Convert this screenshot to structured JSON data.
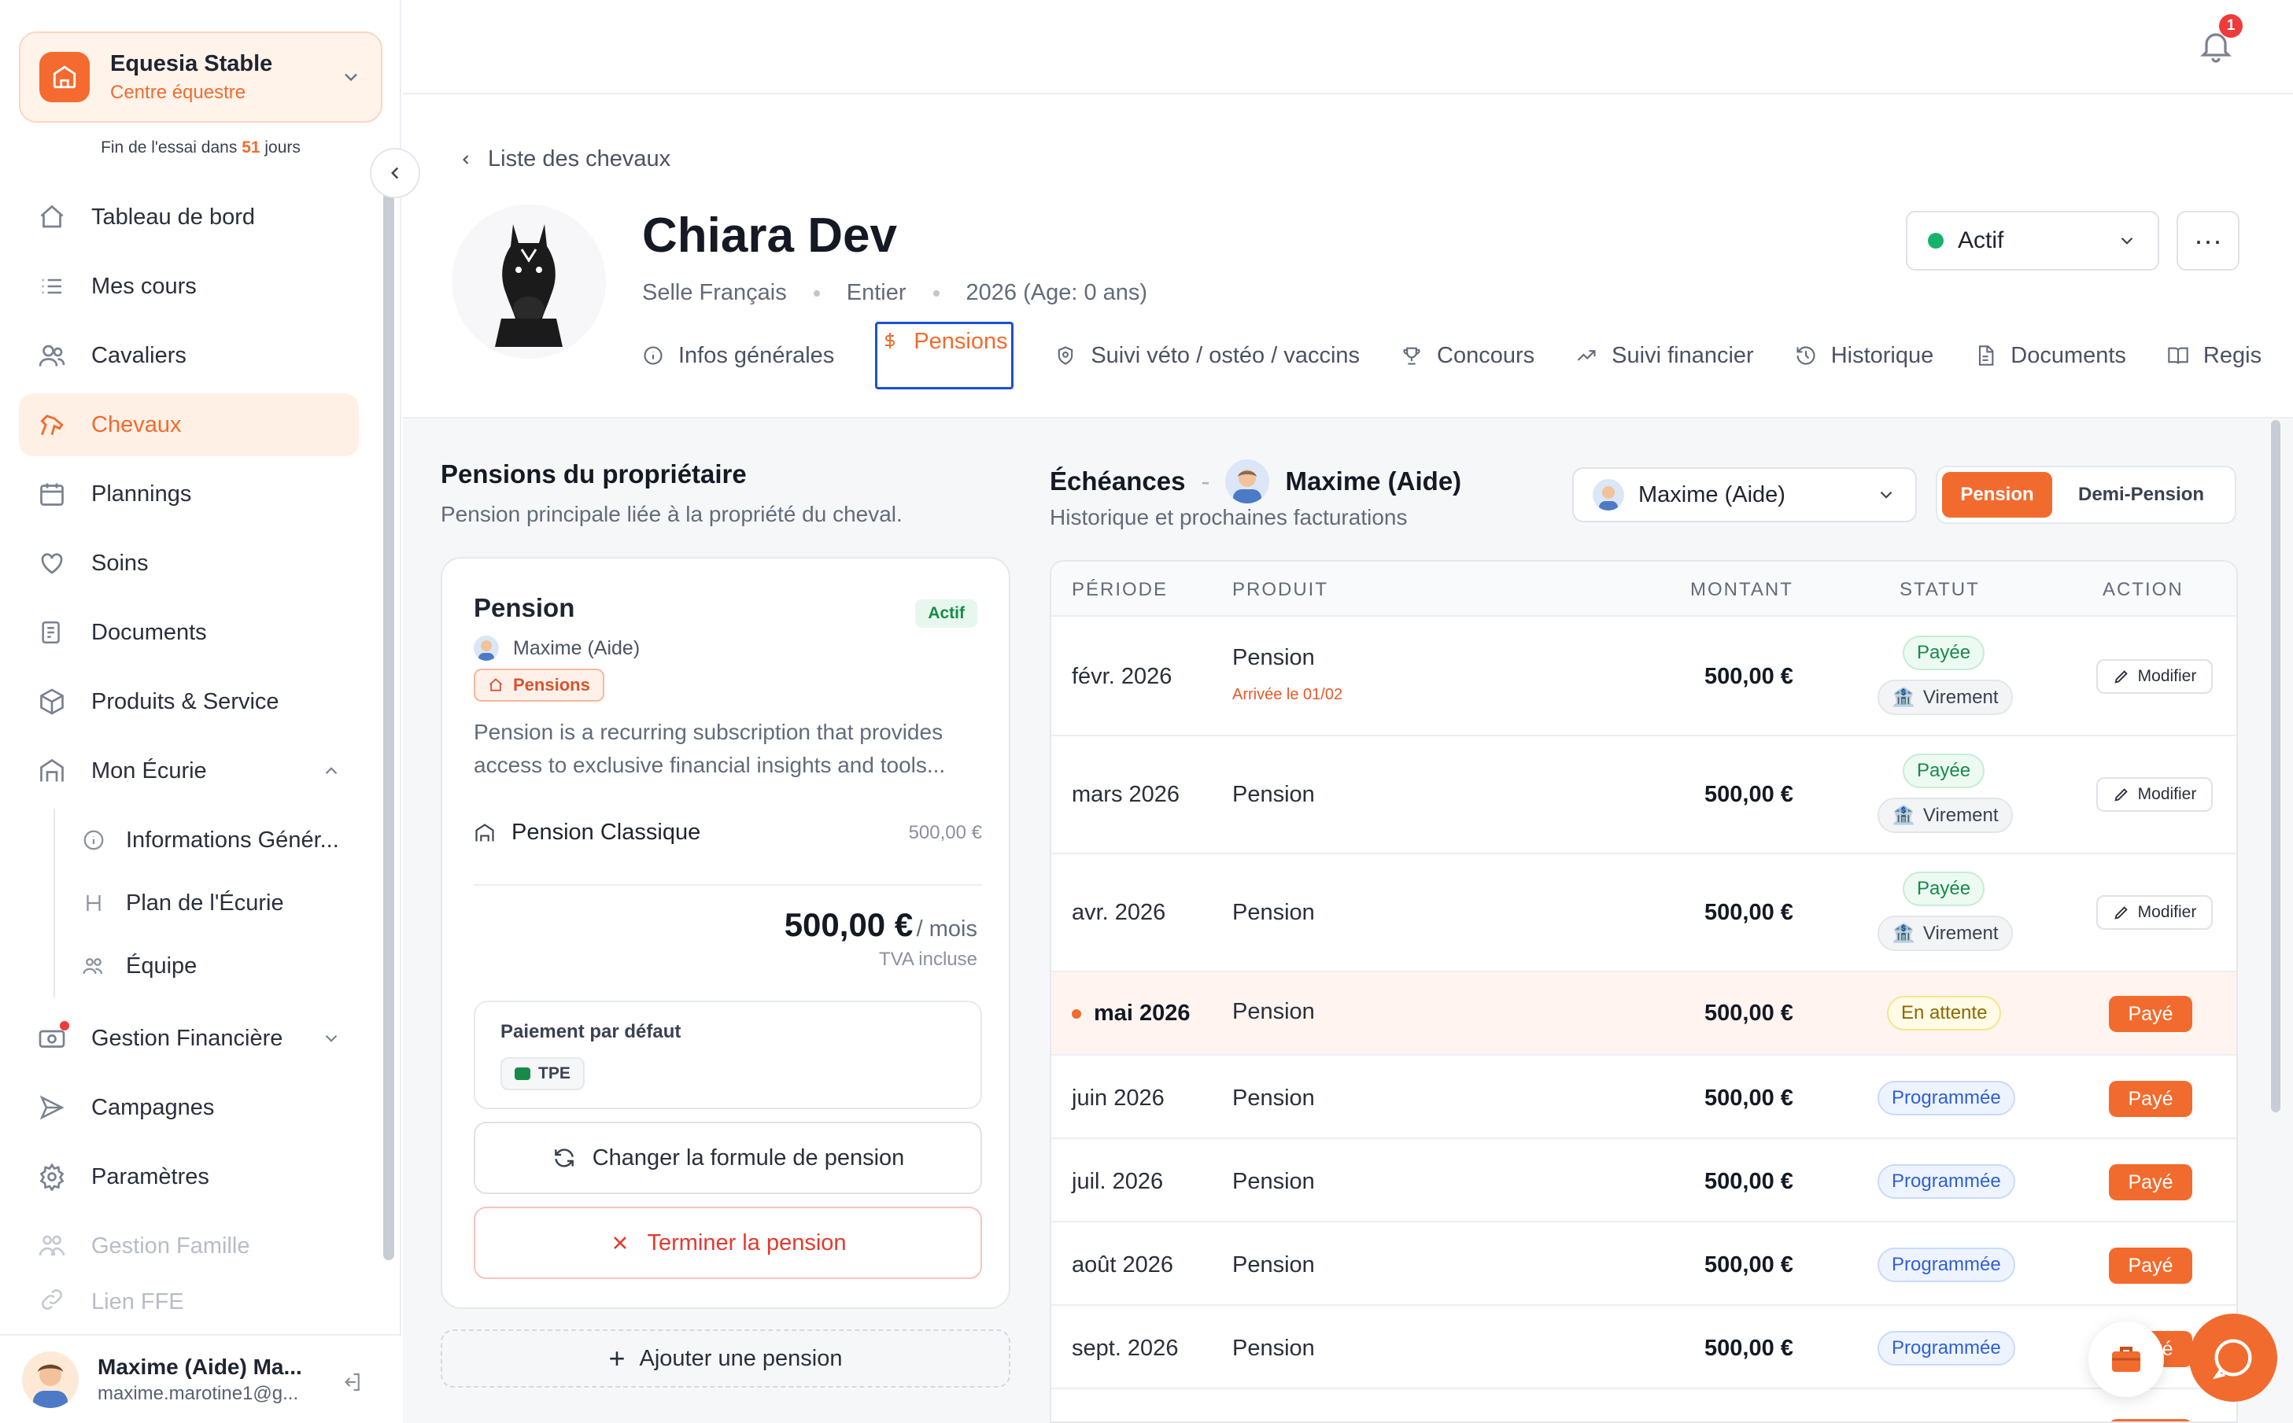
{
  "sidebar": {
    "club": {
      "name": "Equesia Stable",
      "type": "Centre équestre"
    },
    "trial": {
      "prefix": "Fin de l'essai dans",
      "days": "51",
      "suffix": "jours"
    },
    "nav": [
      {
        "label": "Tableau de bord",
        "icon": "home-icon"
      },
      {
        "label": "Mes cours",
        "icon": "list-icon"
      },
      {
        "label": "Cavaliers",
        "icon": "users-icon"
      },
      {
        "label": "Chevaux",
        "icon": "horse-icon",
        "active": true
      },
      {
        "label": "Plannings",
        "icon": "calendar-icon"
      },
      {
        "label": "Soins",
        "icon": "heart-icon"
      },
      {
        "label": "Documents",
        "icon": "document-icon"
      },
      {
        "label": "Produits & Service",
        "icon": "box-icon"
      },
      {
        "label": "Mon Écurie",
        "icon": "stable-icon"
      }
    ],
    "stable_sub": [
      {
        "label": "Informations Génér...",
        "icon": "info-icon"
      },
      {
        "label": "Plan de l'Écurie",
        "icon": "map-icon"
      },
      {
        "label": "Équipe",
        "icon": "team-icon"
      }
    ],
    "nav2": [
      {
        "label": "Gestion Financière",
        "icon": "finance-icon"
      },
      {
        "label": "Campagnes",
        "icon": "send-icon"
      },
      {
        "label": "Paramètres",
        "icon": "gear-icon"
      },
      {
        "label": "Gestion Famille",
        "icon": "family-icon"
      },
      {
        "label": "Lien FFE",
        "icon": "link-icon"
      }
    ],
    "user": {
      "name": "Maxime (Aide) Ma...",
      "email": "maxime.marotine1@g..."
    }
  },
  "topbar": {
    "notifications": "1"
  },
  "header": {
    "back_label": "Liste des chevaux",
    "horse_name": "Chiara Dev",
    "breed": "Selle Français",
    "sex": "Entier",
    "birth": "2026 (Age: 0 ans)",
    "status": "Actif",
    "more": "···",
    "tabs": [
      {
        "label": "Infos générales",
        "icon": "info-icon"
      },
      {
        "label": "Pensions",
        "icon": "dollar-icon",
        "active": true
      },
      {
        "label": "Suivi véto / ostéo / vaccins",
        "icon": "shield-icon"
      },
      {
        "label": "Concours",
        "icon": "trophy-icon"
      },
      {
        "label": "Suivi financier",
        "icon": "trending-icon"
      },
      {
        "label": "Historique",
        "icon": "history-icon"
      },
      {
        "label": "Documents",
        "icon": "file-icon"
      },
      {
        "label": "Regis",
        "icon": "book-icon"
      }
    ]
  },
  "pensions": {
    "title": "Pensions du propriétaire",
    "subtitle": "Pension principale liée à la propriété du cheval.",
    "card": {
      "title": "Pension",
      "status": "Actif",
      "owner": "Maxime (Aide)",
      "tag": "Pensions",
      "description": "Pension is a recurring subscription that provides access to exclusive financial insights and tools...",
      "line_label": "Pension Classique",
      "line_price": "500,00 €",
      "total": "500,00 €",
      "period": "/ mois",
      "tva": "TVA incluse",
      "payment_label": "Paiement par défaut",
      "payment_method": "TPE",
      "change_label": "Changer la formule de pension",
      "end_label": "Terminer la pension"
    },
    "add_label": "Ajouter une pension"
  },
  "echeances": {
    "title": "Échéances",
    "person": "Maxime (Aide)",
    "subtitle": "Historique et prochaines facturations",
    "select_value": "Maxime (Aide)",
    "toggle": {
      "on": "Pension",
      "off": "Demi-Pension"
    },
    "columns": [
      "PÉRIODE",
      "PRODUIT",
      "MONTANT",
      "STATUT",
      "ACTION"
    ],
    "rows": [
      {
        "period": "févr. 2026",
        "product": "Pension",
        "note": "Arrivée le 01/02",
        "amount": "500,00 €",
        "status": "Payée",
        "method": "Virement",
        "action": "Modifier"
      },
      {
        "period": "mars 2026",
        "product": "Pension",
        "note": "",
        "amount": "500,00 €",
        "status": "Payée",
        "method": "Virement",
        "action": "Modifier"
      },
      {
        "period": "avr. 2026",
        "product": "Pension",
        "note": "",
        "amount": "500,00 €",
        "status": "Payée",
        "method": "Virement",
        "action": "Modifier"
      },
      {
        "period": "mai 2026",
        "product": "Pension",
        "note": "",
        "amount": "500,00 €",
        "status": "En attente",
        "method": "",
        "action": "Payé"
      },
      {
        "period": "juin 2026",
        "product": "Pension",
        "note": "",
        "amount": "500,00 €",
        "status": "Programmée",
        "method": "",
        "action": "Payé"
      },
      {
        "period": "juil. 2026",
        "product": "Pension",
        "note": "",
        "amount": "500,00 €",
        "status": "Programmée",
        "method": "",
        "action": "Payé"
      },
      {
        "period": "août 2026",
        "product": "Pension",
        "note": "",
        "amount": "500,00 €",
        "status": "Programmée",
        "method": "",
        "action": "Payé"
      },
      {
        "period": "sept. 2026",
        "product": "Pension",
        "note": "",
        "amount": "500,00 €",
        "status": "Programmée",
        "method": "",
        "action": "Payé"
      }
    ]
  },
  "colors": {
    "accent": "#f26b2e",
    "success": "#17b26a",
    "danger": "#e5392f",
    "info": "#2f5fd6"
  }
}
